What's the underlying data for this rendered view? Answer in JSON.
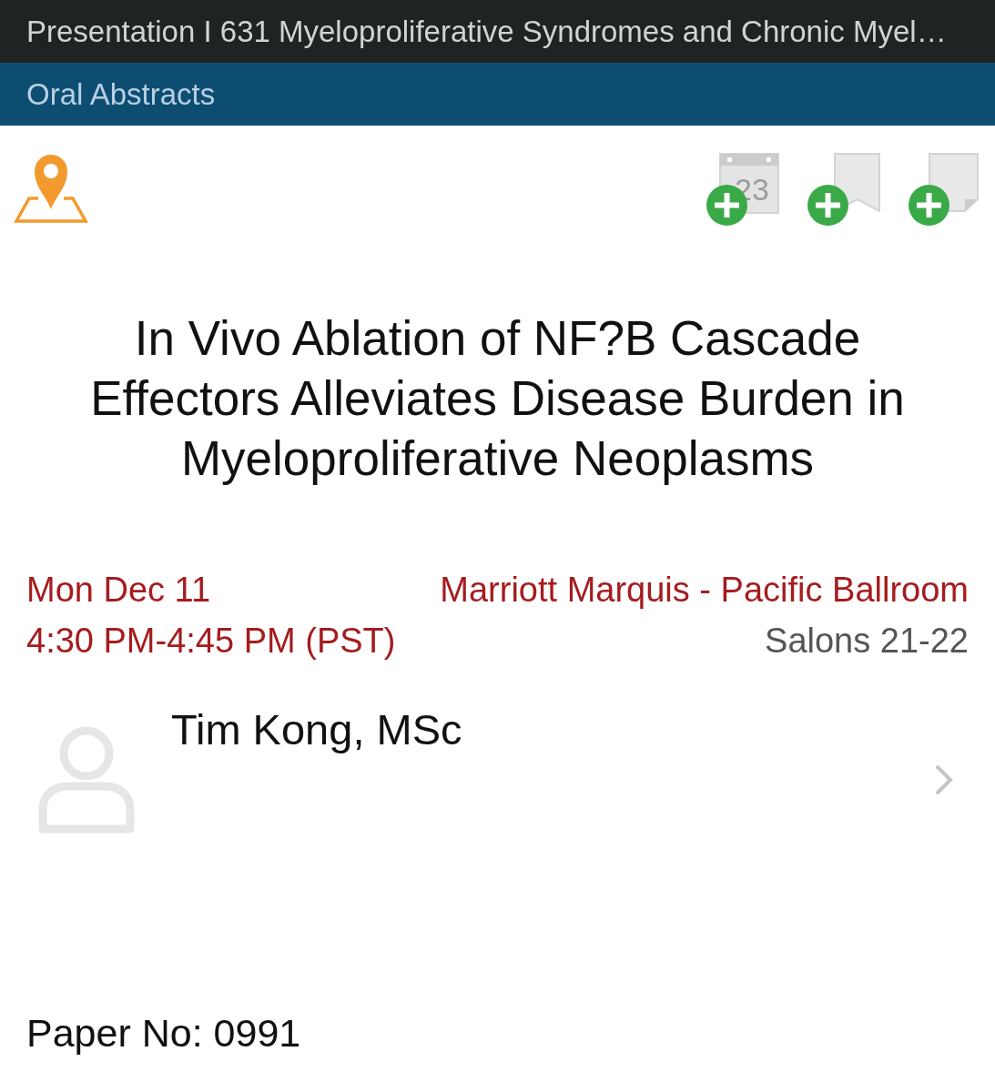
{
  "header": {
    "title": "Presentation I 631 Myeloproliferative Syndromes and Chronic Myel…"
  },
  "session_bar": {
    "label": "Oral Abstracts"
  },
  "toolbar": {
    "actions": [
      {
        "kind": "calendar",
        "day": "23"
      },
      {
        "kind": "bookmark"
      },
      {
        "kind": "note"
      }
    ]
  },
  "abstract": {
    "title": "In Vivo Ablation of NF?B Cascade Effectors Alleviates Disease Burden in Myeloproliferative Neoplasms"
  },
  "schedule": {
    "date": "Mon Dec 11",
    "time": "4:30 PM-4:45 PM (PST)",
    "venue": "Marriott Marquis - Pacific Ballroom",
    "room": "Salons 21-22"
  },
  "speakers": [
    {
      "name": "Tim Kong, MSc"
    }
  ],
  "paper": {
    "number": "Paper No: 0991"
  }
}
